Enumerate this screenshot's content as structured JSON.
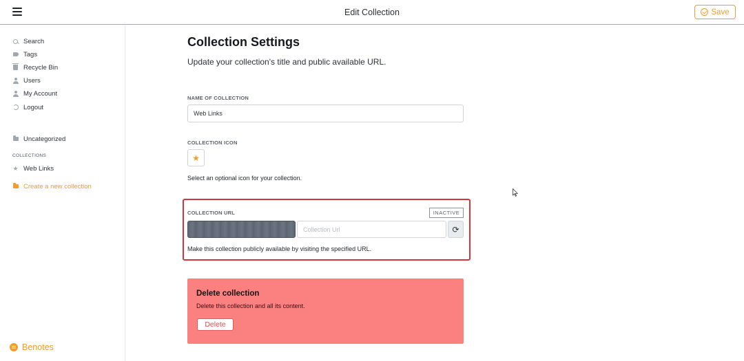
{
  "header": {
    "title": "Edit Collection",
    "save_label": "Save",
    "accent_color": "#f39c2b"
  },
  "sidebar": {
    "nav": [
      {
        "label": "Search",
        "icon": "search-icon"
      },
      {
        "label": "Tags",
        "icon": "tag-icon"
      },
      {
        "label": "Recycle Bin",
        "icon": "trash-icon"
      },
      {
        "label": "Users",
        "icon": "users-icon"
      },
      {
        "label": "My Account",
        "icon": "user-icon"
      },
      {
        "label": "Logout",
        "icon": "logout-icon"
      }
    ],
    "uncategorized": "Uncategorized",
    "collections_heading": "COLLECTIONS",
    "collections": [
      {
        "label": "Web Links",
        "icon": "star-icon"
      }
    ],
    "create_label": "Create a new collection",
    "brand": "Benotes"
  },
  "main": {
    "title": "Collection Settings",
    "subtitle": "Update your collection's title and public available URL.",
    "name_label": "NAME OF COLLECTION",
    "name_value": "Web Links",
    "icon_label": "COLLECTION ICON",
    "icon_glyph": "★",
    "icon_help": "Select an optional icon for your collection.",
    "url_label": "COLLECTION URL",
    "url_status": "INACTIVE",
    "url_placeholder": "Collection Url",
    "url_help": "Make this collection publicly available by visiting the specified URL.",
    "delete": {
      "title": "Delete collection",
      "text": "Delete this collection and all its content.",
      "button": "Delete",
      "color": "#fb8181"
    }
  }
}
